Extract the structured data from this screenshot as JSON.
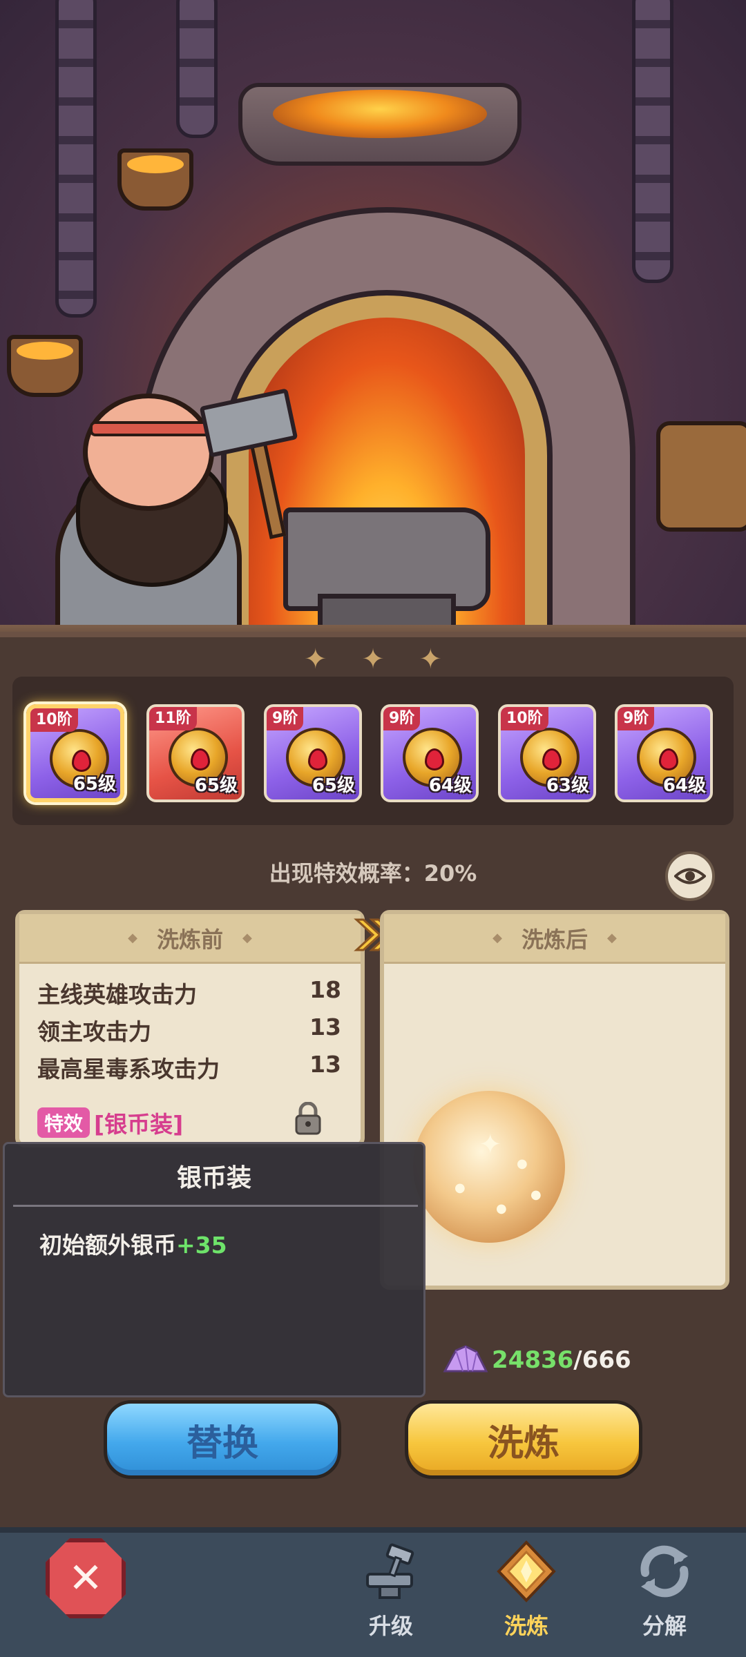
{
  "gear_items": [
    {
      "tier": "10阶",
      "level": "65级",
      "icon": "necklace-icon",
      "rarity": "purple",
      "selected": true
    },
    {
      "tier": "11阶",
      "level": "65级",
      "icon": "shield-icon",
      "rarity": "red",
      "selected": false
    },
    {
      "tier": "9阶",
      "level": "65级",
      "icon": "belt-icon",
      "rarity": "purple",
      "selected": false
    },
    {
      "tier": "9阶",
      "level": "64级",
      "icon": "crown-icon",
      "rarity": "purple",
      "selected": false
    },
    {
      "tier": "10阶",
      "level": "63级",
      "icon": "armor-icon",
      "rarity": "purple",
      "selected": false
    },
    {
      "tier": "9阶",
      "level": "64级",
      "icon": "helmet-icon",
      "rarity": "purple",
      "selected": false
    }
  ],
  "chance_text": "出现特效概率：20%",
  "before_card": {
    "title": "洗炼前",
    "attributes": [
      {
        "name": "主线英雄攻击力",
        "value": "18"
      },
      {
        "name": "领主攻击力",
        "value": "13"
      },
      {
        "name": "最高星毒系攻击力",
        "value": "13"
      }
    ],
    "effect_tag": "特效",
    "effect_name": "[银币装]"
  },
  "after_card": {
    "title": "洗炼后"
  },
  "tooltip": {
    "title": "银币装",
    "desc_label": "初始额外银币",
    "desc_value": "+35"
  },
  "currency": {
    "have": "24836",
    "need": "/666",
    "icon": "crystal-icon"
  },
  "buttons": {
    "replace": "替换",
    "refine": "洗炼"
  },
  "nav": {
    "close_icon": "close-icon",
    "items": [
      {
        "label": "升级",
        "icon": "anvil-hammer-icon",
        "active": false
      },
      {
        "label": "洗炼",
        "icon": "refine-diamond-icon",
        "active": true
      },
      {
        "label": "分解",
        "icon": "recycle-icon",
        "active": false
      }
    ]
  },
  "colors": {
    "panel_bg": "#4b3a33",
    "card_bg": "#eee4cf",
    "effect_tag": "#e35aa6",
    "effect_name": "#d63d8e",
    "positive_value": "#6ee36a",
    "replace_button": "#43a8ec",
    "refine_button": "#f7c63d",
    "nav_active": "#ffd35a"
  }
}
